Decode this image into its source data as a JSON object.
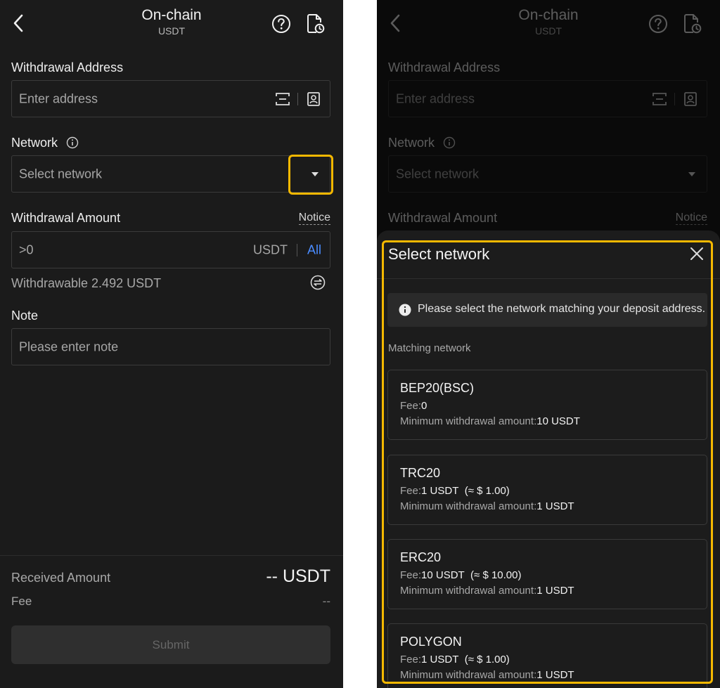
{
  "header": {
    "title": "On-chain",
    "subtitle": "USDT",
    "back_icon": "chevron-left-icon",
    "help_icon": "question-circle-icon",
    "records_icon": "document-clock-icon"
  },
  "form": {
    "address_label": "Withdrawal Address",
    "address_placeholder": "Enter address",
    "network_label": "Network",
    "network_placeholder": "Select network",
    "amount_label": "Withdrawal Amount",
    "notice_link": "Notice",
    "amount_placeholder": ">0",
    "amount_unit": "USDT",
    "all_link": "All",
    "withdrawable_text": "Withdrawable 2.492 USDT",
    "note_label": "Note",
    "note_placeholder": "Please enter note"
  },
  "summary": {
    "received_label": "Received Amount",
    "received_value": "-- USDT",
    "fee_label": "Fee",
    "fee_value": "--",
    "submit_label": "Submit"
  },
  "network_sheet": {
    "title": "Select network",
    "tip": "Please select the network matching your deposit address.",
    "matching_label": "Matching network",
    "fee_prefix": "Fee:",
    "min_prefix": "Minimum withdrawal amount:",
    "networks": [
      {
        "name": "BEP20(BSC)",
        "fee": "0",
        "fee_approx": "",
        "min_amount": "10 USDT"
      },
      {
        "name": "TRC20",
        "fee": "1 USDT",
        "fee_approx": "(≈ $ 1.00)",
        "min_amount": "1 USDT"
      },
      {
        "name": "ERC20",
        "fee": "10 USDT",
        "fee_approx": "(≈ $ 10.00)",
        "min_amount": "1 USDT"
      },
      {
        "name": "POLYGON",
        "fee": "1 USDT",
        "fee_approx": "(≈ $ 1.00)",
        "min_amount": "1 USDT"
      }
    ]
  },
  "colors": {
    "background": "#1b1b1b",
    "highlight": "#f5b800",
    "link": "#4a8cff"
  }
}
